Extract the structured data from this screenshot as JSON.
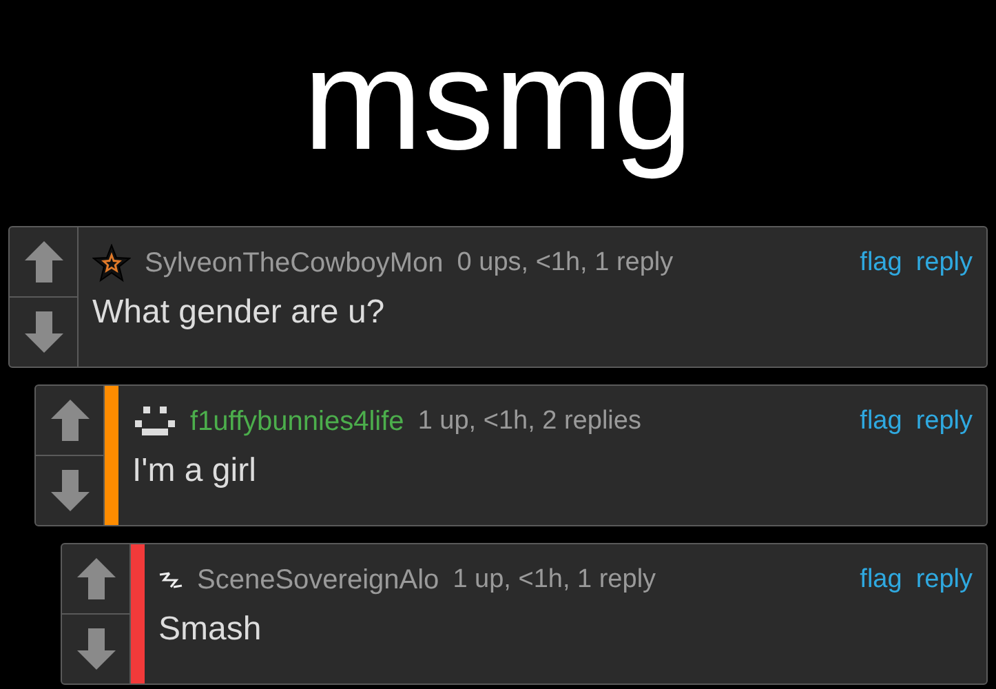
{
  "caption": "msmg",
  "comments": [
    {
      "kind": "star",
      "user": {
        "name": "SylveonTheCowboyMon",
        "color": "#9a9a9a"
      },
      "meta": "0 ups, <1h, 1 reply",
      "text": "What gender are u?",
      "actions": [
        "flag",
        "reply"
      ],
      "children": [
        {
          "kind": "smiley",
          "user": {
            "name": "f1uffybunnies4life",
            "color": "#4cae4c"
          },
          "color": "#ff8c00",
          "meta": "1 up, <1h, 2 replies",
          "text": "I'm a girl",
          "actions": [
            "flag",
            "reply"
          ],
          "children": [
            {
              "kind": "squiggle",
              "user": {
                "name": "SceneSovereignAlo",
                "color": "#9a9a9a"
              },
              "color": "#f23a3a",
              "meta": "1 up, <1h, 1 reply",
              "text": "Smash",
              "actions": [
                "flag",
                "reply"
              ]
            }
          ]
        }
      ]
    }
  ]
}
